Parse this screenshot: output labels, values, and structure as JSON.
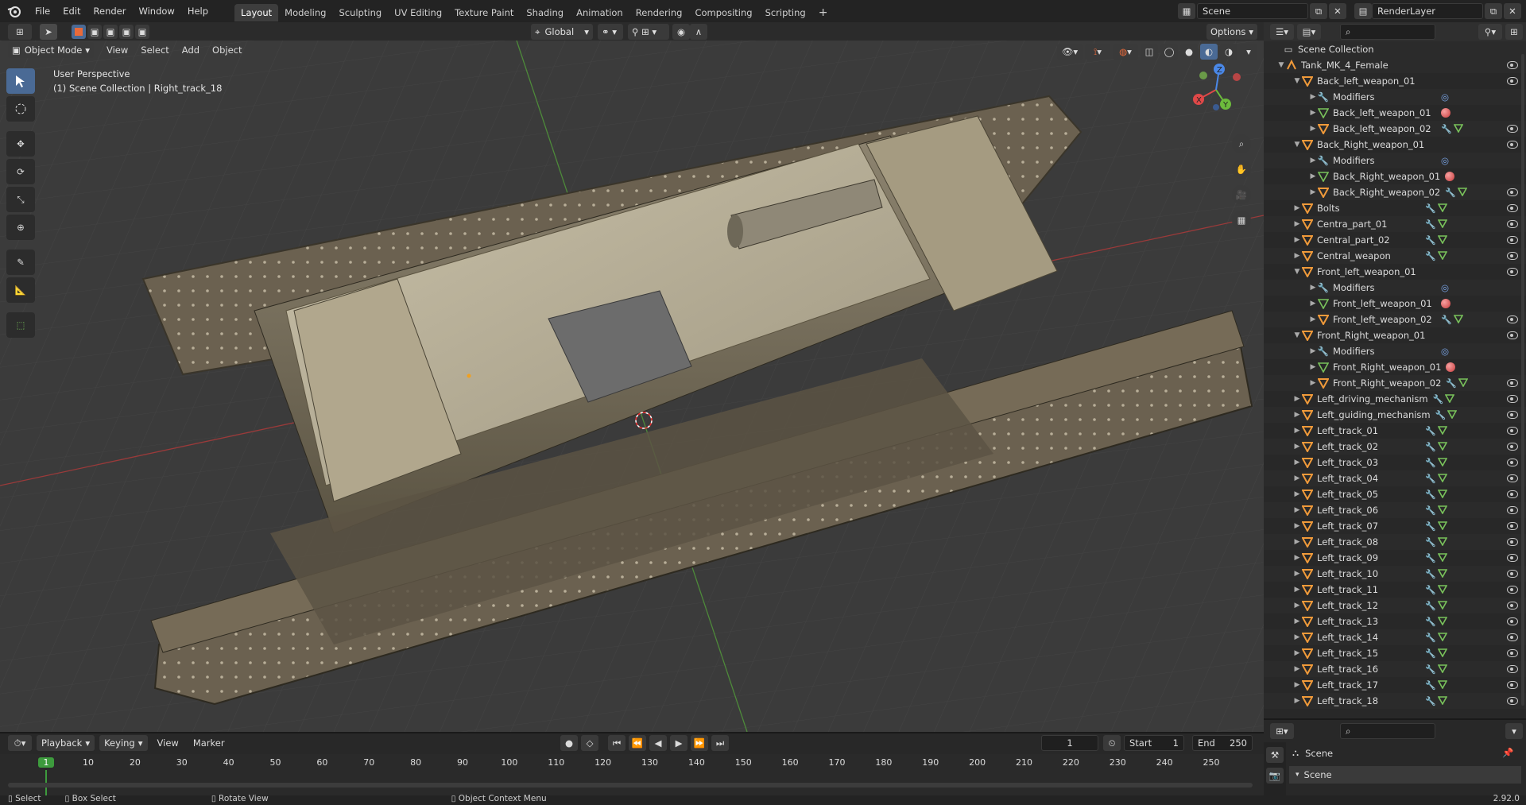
{
  "topbar": {
    "menus": [
      "File",
      "Edit",
      "Render",
      "Window",
      "Help"
    ],
    "workspaces": [
      "Layout",
      "Modeling",
      "Sculpting",
      "UV Editing",
      "Texture Paint",
      "Shading",
      "Animation",
      "Rendering",
      "Compositing",
      "Scripting"
    ],
    "active_workspace": "Layout",
    "add_tab": "+",
    "scene": "Scene",
    "view_layer": "RenderLayer"
  },
  "viewport_header": {
    "mode": "Object Mode",
    "menus": [
      "View",
      "Select",
      "Add",
      "Object"
    ],
    "orientation": "Global",
    "options": "Options"
  },
  "viewport": {
    "line1": "User Perspective",
    "line2": "(1) Scene Collection | Right_track_18",
    "gizmo_axes": [
      "X",
      "Y",
      "Z"
    ]
  },
  "outliner": {
    "root": "Scene Collection",
    "rows": [
      {
        "label": "Tank_MK_4_Female",
        "indent": 1,
        "expanded": true,
        "type": "armature",
        "extras": [],
        "eye": true
      },
      {
        "label": "Back_left_weapon_01",
        "indent": 2,
        "expanded": true,
        "type": "object",
        "extras": [],
        "eye": true
      },
      {
        "label": "Modifiers",
        "indent": 3,
        "expanded": false,
        "type": "modifier",
        "extras": [
          "modset"
        ],
        "eye": false
      },
      {
        "label": "Back_left_weapon_01",
        "indent": 3,
        "expanded": false,
        "type": "meshdata",
        "extras": [
          "mat"
        ],
        "eye": false
      },
      {
        "label": "Back_left_weapon_02",
        "indent": 3,
        "expanded": false,
        "type": "object",
        "extras": [
          "wrench",
          "mesh"
        ],
        "eye": true
      },
      {
        "label": "Back_Right_weapon_01",
        "indent": 2,
        "expanded": true,
        "type": "object",
        "extras": [],
        "eye": true
      },
      {
        "label": "Modifiers",
        "indent": 3,
        "expanded": false,
        "type": "modifier",
        "extras": [
          "modset"
        ],
        "eye": false
      },
      {
        "label": "Back_Right_weapon_01",
        "indent": 3,
        "expanded": false,
        "type": "meshdata",
        "extras": [
          "mat"
        ],
        "eye": false
      },
      {
        "label": "Back_Right_weapon_02",
        "indent": 3,
        "expanded": false,
        "type": "object",
        "extras": [
          "wrench",
          "mesh"
        ],
        "eye": true
      },
      {
        "label": "Bolts",
        "indent": 2,
        "expanded": false,
        "type": "object",
        "extras": [
          "wrench",
          "mesh"
        ],
        "eye": true
      },
      {
        "label": "Centra_part_01",
        "indent": 2,
        "expanded": false,
        "type": "object",
        "extras": [
          "wrench",
          "mesh"
        ],
        "eye": true
      },
      {
        "label": "Central_part_02",
        "indent": 2,
        "expanded": false,
        "type": "object",
        "extras": [
          "wrench",
          "mesh"
        ],
        "eye": true
      },
      {
        "label": "Central_weapon",
        "indent": 2,
        "expanded": false,
        "type": "object",
        "extras": [
          "wrench",
          "mesh"
        ],
        "eye": true
      },
      {
        "label": "Front_left_weapon_01",
        "indent": 2,
        "expanded": true,
        "type": "object",
        "extras": [],
        "eye": true
      },
      {
        "label": "Modifiers",
        "indent": 3,
        "expanded": false,
        "type": "modifier",
        "extras": [
          "modset"
        ],
        "eye": false
      },
      {
        "label": "Front_left_weapon_01",
        "indent": 3,
        "expanded": false,
        "type": "meshdata",
        "extras": [
          "mat"
        ],
        "eye": false
      },
      {
        "label": "Front_left_weapon_02",
        "indent": 3,
        "expanded": false,
        "type": "object",
        "extras": [
          "wrench",
          "mesh"
        ],
        "eye": true
      },
      {
        "label": "Front_Right_weapon_01",
        "indent": 2,
        "expanded": true,
        "type": "object",
        "extras": [],
        "eye": true
      },
      {
        "label": "Modifiers",
        "indent": 3,
        "expanded": false,
        "type": "modifier",
        "extras": [
          "modset"
        ],
        "eye": false
      },
      {
        "label": "Front_Right_weapon_01",
        "indent": 3,
        "expanded": false,
        "type": "meshdata",
        "extras": [
          "mat"
        ],
        "eye": false
      },
      {
        "label": "Front_Right_weapon_02",
        "indent": 3,
        "expanded": false,
        "type": "object",
        "extras": [
          "wrench",
          "mesh"
        ],
        "eye": true
      },
      {
        "label": "Left_driving_mechanism",
        "indent": 2,
        "expanded": false,
        "type": "object",
        "extras": [
          "wrench",
          "mesh"
        ],
        "eye": true
      },
      {
        "label": "Left_guiding_mechanism",
        "indent": 2,
        "expanded": false,
        "type": "object",
        "extras": [
          "wrench",
          "mesh"
        ],
        "eye": true
      },
      {
        "label": "Left_track_01",
        "indent": 2,
        "expanded": false,
        "type": "object",
        "extras": [
          "wrench",
          "mesh"
        ],
        "eye": true
      },
      {
        "label": "Left_track_02",
        "indent": 2,
        "expanded": false,
        "type": "object",
        "extras": [
          "wrench",
          "mesh"
        ],
        "eye": true
      },
      {
        "label": "Left_track_03",
        "indent": 2,
        "expanded": false,
        "type": "object",
        "extras": [
          "wrench",
          "mesh"
        ],
        "eye": true
      },
      {
        "label": "Left_track_04",
        "indent": 2,
        "expanded": false,
        "type": "object",
        "extras": [
          "wrench",
          "mesh"
        ],
        "eye": true
      },
      {
        "label": "Left_track_05",
        "indent": 2,
        "expanded": false,
        "type": "object",
        "extras": [
          "wrench",
          "mesh"
        ],
        "eye": true
      },
      {
        "label": "Left_track_06",
        "indent": 2,
        "expanded": false,
        "type": "object",
        "extras": [
          "wrench",
          "mesh"
        ],
        "eye": true
      },
      {
        "label": "Left_track_07",
        "indent": 2,
        "expanded": false,
        "type": "object",
        "extras": [
          "wrench",
          "mesh"
        ],
        "eye": true
      },
      {
        "label": "Left_track_08",
        "indent": 2,
        "expanded": false,
        "type": "object",
        "extras": [
          "wrench",
          "mesh"
        ],
        "eye": true
      },
      {
        "label": "Left_track_09",
        "indent": 2,
        "expanded": false,
        "type": "object",
        "extras": [
          "wrench",
          "mesh"
        ],
        "eye": true
      },
      {
        "label": "Left_track_10",
        "indent": 2,
        "expanded": false,
        "type": "object",
        "extras": [
          "wrench",
          "mesh"
        ],
        "eye": true
      },
      {
        "label": "Left_track_11",
        "indent": 2,
        "expanded": false,
        "type": "object",
        "extras": [
          "wrench",
          "mesh"
        ],
        "eye": true
      },
      {
        "label": "Left_track_12",
        "indent": 2,
        "expanded": false,
        "type": "object",
        "extras": [
          "wrench",
          "mesh"
        ],
        "eye": true
      },
      {
        "label": "Left_track_13",
        "indent": 2,
        "expanded": false,
        "type": "object",
        "extras": [
          "wrench",
          "mesh"
        ],
        "eye": true
      },
      {
        "label": "Left_track_14",
        "indent": 2,
        "expanded": false,
        "type": "object",
        "extras": [
          "wrench",
          "mesh"
        ],
        "eye": true
      },
      {
        "label": "Left_track_15",
        "indent": 2,
        "expanded": false,
        "type": "object",
        "extras": [
          "wrench",
          "mesh"
        ],
        "eye": true
      },
      {
        "label": "Left_track_16",
        "indent": 2,
        "expanded": false,
        "type": "object",
        "extras": [
          "wrench",
          "mesh"
        ],
        "eye": true
      },
      {
        "label": "Left_track_17",
        "indent": 2,
        "expanded": false,
        "type": "object",
        "extras": [
          "wrench",
          "mesh"
        ],
        "eye": true
      },
      {
        "label": "Left_track_18",
        "indent": 2,
        "expanded": false,
        "type": "object",
        "extras": [
          "wrench",
          "mesh"
        ],
        "eye": true
      }
    ]
  },
  "properties": {
    "scene_label": "Scene",
    "panel_label": "Scene"
  },
  "timeline": {
    "menus": [
      "Playback",
      "Keying",
      "View",
      "Marker"
    ],
    "current_frame": "1",
    "start_label": "Start",
    "start": "1",
    "end_label": "End",
    "end": "250",
    "ticks": [
      "1",
      "10",
      "20",
      "30",
      "40",
      "50",
      "60",
      "70",
      "80",
      "90",
      "100",
      "110",
      "120",
      "130",
      "140",
      "150",
      "160",
      "170",
      "180",
      "190",
      "200",
      "210",
      "220",
      "230",
      "240",
      "250"
    ]
  },
  "statusbar": {
    "items": [
      "Select",
      "Box Select",
      "Rotate View",
      "Object Context Menu"
    ],
    "version": "2.92.0"
  },
  "colors": {
    "accent": "#4a6a95",
    "active_frame": "#3d9b3d",
    "orange_icon": "#f09a3a"
  }
}
